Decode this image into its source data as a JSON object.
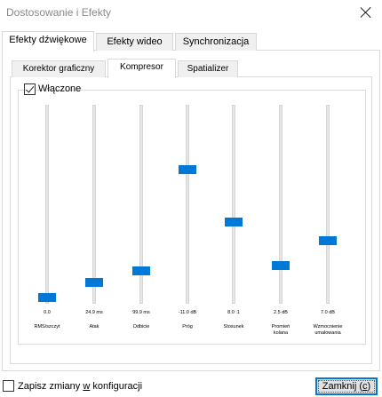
{
  "window": {
    "title": "Dostosowanie i Efekty",
    "close_icon": "close-icon"
  },
  "outer_tabs": [
    {
      "label": "Efekty dźwiękowe",
      "active": true
    },
    {
      "label": "Efekty wideo",
      "active": false
    },
    {
      "label": "Synchronizacja",
      "active": false
    }
  ],
  "inner_tabs": [
    {
      "label": "Korektor graficzny",
      "active": false
    },
    {
      "label": "Kompresor",
      "active": true
    },
    {
      "label": "Spatializer",
      "active": false
    }
  ],
  "compressor": {
    "enabled_label": "Włączone",
    "enabled": true,
    "sliders": [
      {
        "value": "0.0",
        "label": "RMS/szczyt",
        "level": 0.0
      },
      {
        "value": "24.9 ms",
        "label": "Atak",
        "level": 0.08
      },
      {
        "value": "99.9 ms",
        "label": "Odbicie",
        "level": 0.14
      },
      {
        "value": "-11.0 dB",
        "label": "Próg",
        "level": 0.68
      },
      {
        "value": "8.0 :1",
        "label": "Stosunek",
        "level": 0.4
      },
      {
        "value": "2.5 dB",
        "label": "Promień kolana",
        "level": 0.17
      },
      {
        "value": "7.0 dB",
        "label": "Wzmocnienie umalowania",
        "level": 0.3
      }
    ]
  },
  "footer": {
    "save_label_pre": "Zapisz zmiany ",
    "save_label_key": "w",
    "save_label_post": " konfiguracji",
    "save_checked": false,
    "close_pre": "Zamknij (",
    "close_key": "c",
    "close_post": ")"
  },
  "colors": {
    "accent": "#0078d7",
    "title_text": "#8a8a8a"
  }
}
